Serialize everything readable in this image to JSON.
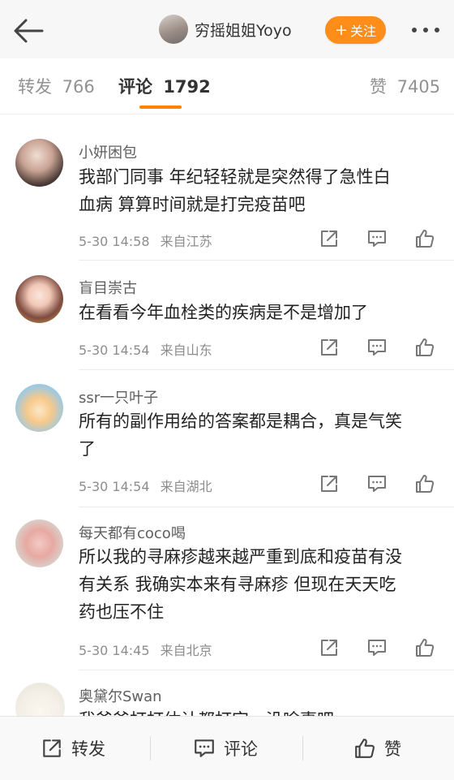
{
  "header": {
    "user_name": "穷摇姐姐Yoyo",
    "follow_label": "关注",
    "follow_plus": "+",
    "accent": "#ff8d1a"
  },
  "tabs": [
    {
      "label": "转发",
      "count": "766"
    },
    {
      "label": "评论",
      "count": "1792"
    },
    {
      "label": "赞",
      "count": "7405"
    }
  ],
  "comments": [
    {
      "name": "小妍困包",
      "text_lines": [
        "我部门同事 年纪轻轻就是突然得了急性白",
        "血病 算算时间就是打完疫苗吧"
      ],
      "time": "5-30 14:58",
      "source": "来自江苏"
    },
    {
      "name": "盲目崇古",
      "text_lines": [
        "在看看今年血栓类的疾病是不是增加了"
      ],
      "time": "5-30 14:54",
      "source": "来自山东"
    },
    {
      "name": "ssr一只叶子",
      "text_lines": [
        "所有的副作用给的答案都是耦合，真是气笑",
        "了"
      ],
      "time": "5-30 14:54",
      "source": "来自湖北"
    },
    {
      "name": "每天都有coco喝",
      "text_lines": [
        "所以我的寻麻疹越来越严重到底和疫苗有没",
        "有关系 我确实本来有寻麻疹 但现在天天吃",
        "药也压不住"
      ],
      "time": "5-30 14:45",
      "source": "来自北京"
    },
    {
      "name": "奥黛尔Swan",
      "text_lines": [
        "我爸爸打打估计都打完，没啥事吧"
      ],
      "time": "",
      "source": ""
    }
  ],
  "bottom_bar": {
    "repost_label": "转发",
    "comment_label": "评论",
    "like_label": "赞"
  }
}
